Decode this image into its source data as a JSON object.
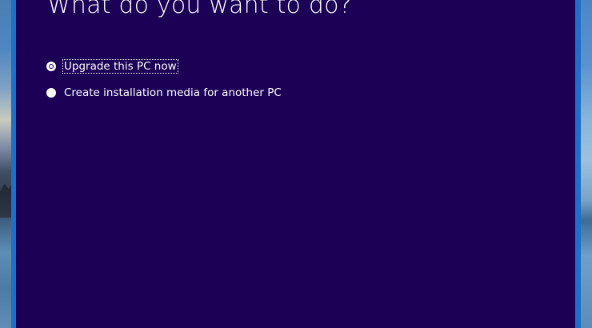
{
  "setup": {
    "heading": "What do you want to do?",
    "options": [
      {
        "label": "Upgrade this PC now",
        "selected": true,
        "focused": true
      },
      {
        "label": "Create installation media for another PC",
        "selected": false,
        "focused": false
      }
    ]
  },
  "colors": {
    "background": "#1b0056",
    "window_border": "#1e6fc8",
    "text": "#ffffff"
  }
}
